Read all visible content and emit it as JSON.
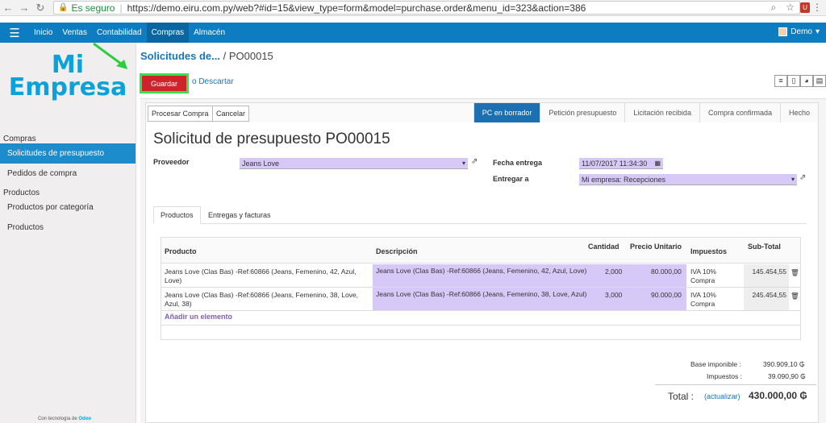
{
  "browser": {
    "secure_label": "Es seguro",
    "url": "https://demo.eiru.com.py/web?#id=15&view_type=form&model=purchase.order&menu_id=323&action=386"
  },
  "topbar": {
    "menu": [
      "Inicio",
      "Ventas",
      "Contabilidad",
      "Compras",
      "Almacén"
    ],
    "active": "Compras",
    "user": "Demo"
  },
  "sidebar": {
    "logo_line1": "Mi",
    "logo_line2": "Empresa",
    "section_compras": "Compras",
    "items_compras": [
      "Solicitudes de presupuesto",
      "Pedidos de compra"
    ],
    "section_productos": "Productos",
    "items_productos": [
      "Productos por categoría",
      "Productos"
    ],
    "powered_prefix": "Con tecnología de",
    "powered_brand": "Odoo"
  },
  "breadcrumb": {
    "parent": "Solicitudes de...",
    "sep": "/",
    "current": "PO00015"
  },
  "actions": {
    "save": "Guardar",
    "discard": "o Descartar"
  },
  "statusbar": {
    "process": "Procesar Compra",
    "cancel": "Cancelar",
    "stages": [
      "PC en borrador",
      "Petición presupuesto",
      "Licitación recibida",
      "Compra confirmada",
      "Hecho"
    ],
    "current_stage": "PC en borrador"
  },
  "form": {
    "title": "Solicitud de presupuesto PO00015",
    "supplier_label": "Proveedor",
    "supplier_value": "Jeans Love",
    "date_label": "Fecha entrega",
    "date_value": "11/07/2017 11:34:30",
    "deliver_label": "Entregar a",
    "deliver_value": "Mi empresa: Recepciones"
  },
  "tabs": [
    "Productos",
    "Entregas y facturas"
  ],
  "table": {
    "headers": [
      "Producto",
      "Descripción",
      "Cantidad",
      "Precio Unitario",
      "Impuestos",
      "Sub-Total"
    ],
    "rows": [
      {
        "product": "Jeans Love (Clas Bas) -Ref:60866 (Jeans, Femenino, 42, Azul, Love)",
        "description": "Jeans Love (Clas Bas) -Ref:60866 (Jeans, Femenino, 42, Azul, Love)",
        "qty": "2,000",
        "price": "80.000,00",
        "tax": "IVA 10% Compra",
        "subtotal": "145.454,55"
      },
      {
        "product": "Jeans Love (Clas Bas) -Ref:60866 (Jeans, Femenino, 38, Love, Azul, 38)",
        "description": "Jeans Love (Clas Bas) -Ref:60866 (Jeans, Femenino, 38, Love, Azul)",
        "qty": "3,000",
        "price": "90.000,00",
        "tax": "IVA 10% Compra",
        "subtotal": "245.454,55"
      }
    ],
    "add_line": "Añadir un elemento"
  },
  "totals": {
    "base_label": "Base imponible :",
    "base_value": "390.909,10 ₲",
    "tax_label": "Impuestos :",
    "tax_value": "39.090,90 ₲",
    "total_label": "Total :",
    "update": "(actualizar)",
    "total_value": "430.000,00 ₲"
  }
}
